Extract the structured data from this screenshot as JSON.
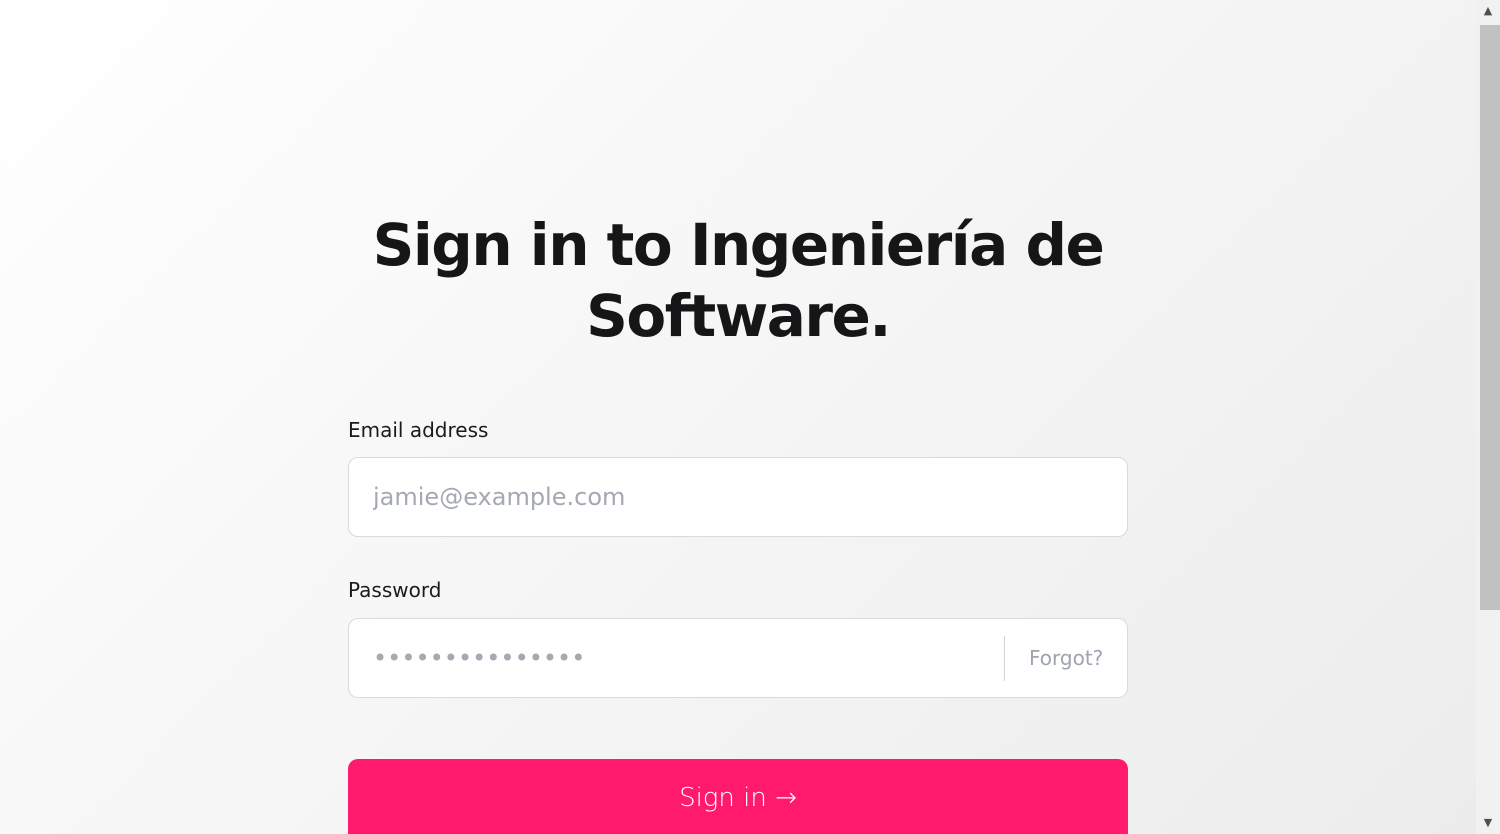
{
  "signin": {
    "title": "Sign in to Ingeniería de Software.",
    "email_label": "Email address",
    "email_placeholder": "jamie@example.com",
    "email_value": "",
    "password_label": "Password",
    "password_placeholder": "•••••••••••••••",
    "password_value": "",
    "forgot_label": "Forgot?",
    "submit_label": "Sign in →"
  },
  "scrollbar": {
    "up_icon": "▲",
    "down_icon": "▼"
  },
  "colors": {
    "accent": "#ff1a6e",
    "title": "#161618",
    "placeholder": "#a4a9b2",
    "link_muted": "#9ea3ad"
  }
}
